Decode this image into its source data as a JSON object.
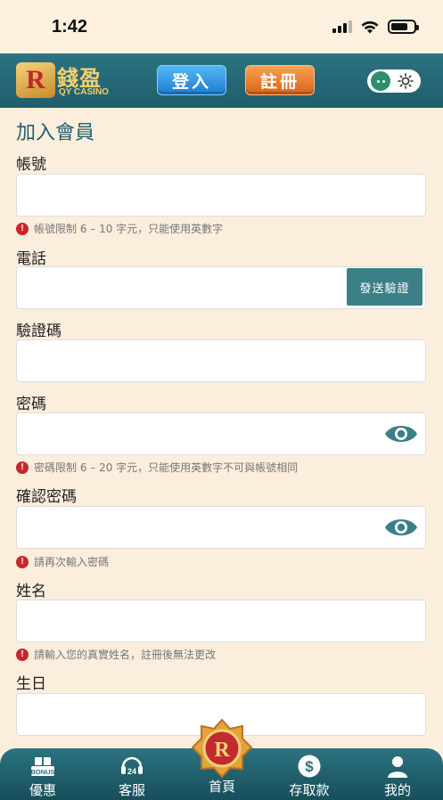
{
  "status": {
    "time": "1:42"
  },
  "header": {
    "logo_mark": "R",
    "logo_text": "錢盈",
    "logo_sub": "QY CASINO",
    "login_label": "登入",
    "register_label": "註冊"
  },
  "form": {
    "title": "加入會員",
    "account_label": "帳號",
    "account_hint": "帳號限制 6 – 10 字元，只能使用英數字",
    "phone_label": "電話",
    "send_code_label": "發送驗證",
    "code_label": "驗證碼",
    "password_label": "密碼",
    "password_hint": "密碼限制 6 – 20 字元，只能使用英數字不可與帳號相同",
    "confirm_label": "確認密碼",
    "confirm_hint": "請再次輸入密碼",
    "name_label": "姓名",
    "name_hint": "請輸入您的真實姓名，註冊後無法更改",
    "birthday_label": "生日"
  },
  "nav": {
    "items": [
      {
        "label": "優惠",
        "icon": "bonus-gift-icon"
      },
      {
        "label": "客服",
        "icon": "support-24-icon"
      },
      {
        "label": "首頁",
        "icon": "home-emblem-icon"
      },
      {
        "label": "存取款",
        "icon": "dollar-coin-icon"
      },
      {
        "label": "我的",
        "icon": "user-profile-icon"
      }
    ],
    "bonus_tag": "BONUS",
    "support_tag": "24"
  },
  "colors": {
    "accent": "#2c7380",
    "background": "#fbeedd",
    "error": "#c8262b"
  }
}
